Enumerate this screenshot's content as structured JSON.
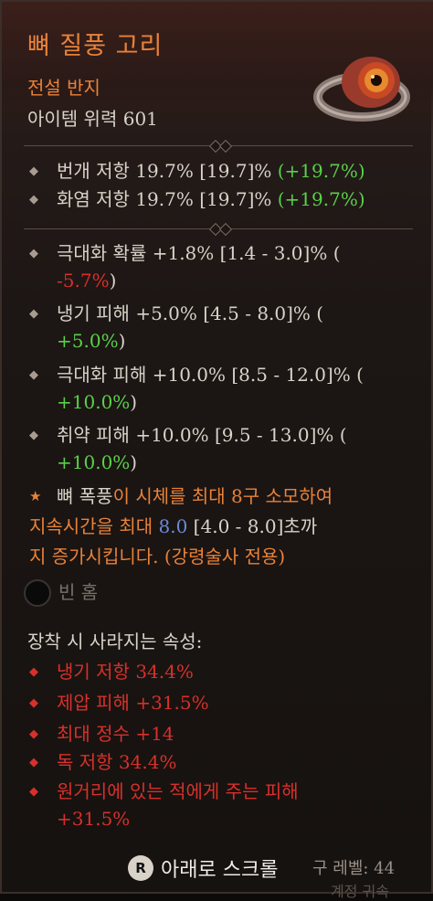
{
  "item": {
    "name": "뼈 질풍 고리",
    "rarity": "전설 반지",
    "power": "아이템 위력 601"
  },
  "implicit_stats": [
    {
      "label": "번개 저항",
      "value": "19.7%",
      "range": "[19.7]%",
      "diff": "(+19.7%)"
    },
    {
      "label": "화염 저항",
      "value": "19.7%",
      "range": "[19.7]%",
      "diff": "(+19.7%)"
    }
  ],
  "affixes": [
    {
      "line1": "극대화 확률 +1.8% [1.4 - 3.0]% (",
      "diff": "-5.7%",
      "diff_color": "red",
      "tail": ")"
    },
    {
      "line1": "냉기 피해 +5.0% [4.5 - 8.0]% (",
      "diff": "+5.0%",
      "diff_color": "green",
      "tail": ")"
    },
    {
      "line1": "극대화 피해 +10.0% [8.5 - 12.0]% (",
      "diff": "+10.0%",
      "diff_color": "green",
      "tail": ")"
    },
    {
      "line1": "취약 피해 +10.0% [9.5 - 13.0]% (",
      "diff": "+10.0%",
      "diff_color": "green",
      "tail": ")"
    }
  ],
  "legendary": {
    "skill": "뼈 폭풍",
    "text_a": "이 시체를 최대 8구 소모하여",
    "text_b": "지속시간을 최대 ",
    "value": "8.0",
    "text_c": " [4.0 - 8.0]초까",
    "text_d": "지 증가시킵니다. (강령술사 전용)"
  },
  "socket": {
    "label": "빈 홈"
  },
  "lost_section": {
    "title": "장착 시 사라지는 속성:",
    "items": [
      "냉기 저항 34.4%",
      "제압 피해 +31.5%",
      "최대 정수 +14",
      "독 저항 34.4%",
      "원거리에 있는 적에게 주는 피해",
      "+31.5%"
    ]
  },
  "footer": {
    "button_icon": "R",
    "scroll_label": "아래로 스크롤",
    "level_label": "구 레벨: 44",
    "faded_text": "계정 귀속"
  },
  "colors": {
    "legendary_orange": "#e8823a",
    "positive_green": "#5ad04a",
    "negative_red": "#d8302a",
    "value_blue": "#6a8ad8"
  },
  "icons": {
    "ring": "ring-item-icon",
    "bullet": "diamond-bullet-icon",
    "legendary": "star-icon",
    "socket": "empty-socket-icon",
    "button": "r-button-icon"
  }
}
